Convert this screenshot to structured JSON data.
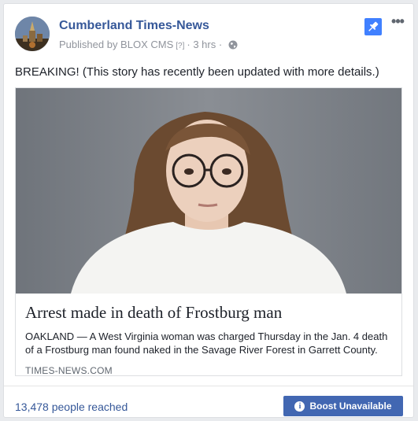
{
  "post": {
    "page_name": "Cumberland Times-News",
    "published_by": "Published by BLOX CMS",
    "help_marker": "[?]",
    "time": "3 hrs",
    "separator": "·",
    "status_text": "BREAKING! (This story has recently been updated with more details.)",
    "more_label": "•••"
  },
  "link": {
    "headline": "Arrest made in death of Frostburg man",
    "snippet": "OAKLAND — A West Virginia woman was charged Thursday in the Jan. 4 death of a Frostburg man found naked in the Savage River Forest in Garrett County.",
    "domain": "TIMES-NEWS.COM"
  },
  "footer": {
    "reach_text": "13,478 people reached",
    "boost_label": "Boost Unavailable"
  },
  "colors": {
    "link_blue": "#365899",
    "boost_blue": "#4267b2",
    "pin_blue": "#4080ff"
  },
  "icons": [
    "avatar-logo",
    "globe-icon",
    "pin-icon",
    "more-icon",
    "info-icon"
  ]
}
